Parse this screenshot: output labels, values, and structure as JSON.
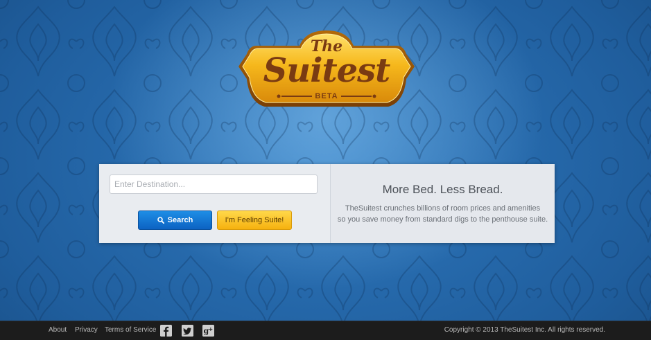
{
  "logo": {
    "top_word": "The",
    "main_word": "Suitest",
    "badge": "BETA"
  },
  "search": {
    "placeholder": "Enter Destination...",
    "value": "",
    "search_label": "Search",
    "lucky_label": "I'm Feeling Suite!"
  },
  "promo": {
    "tagline": "More Bed. Less Bread.",
    "description_line1": "TheSuitest crunches billions of room prices and amenities",
    "description_line2": "so you save money from standard digs to the penthouse suite."
  },
  "footer": {
    "links": [
      "About",
      "Privacy",
      "Terms of Service"
    ],
    "social": [
      "facebook-icon",
      "twitter-icon",
      "google-plus-icon"
    ],
    "copyright": "Copyright © 2013 TheSuitest Inc. All rights reserved."
  },
  "colors": {
    "background_blue": "#1f5d9c",
    "search_button": "#0c62c2",
    "lucky_button": "#f6b10e",
    "logo_gold": "#f0b11a",
    "footer_bg": "#1c1c1c"
  }
}
